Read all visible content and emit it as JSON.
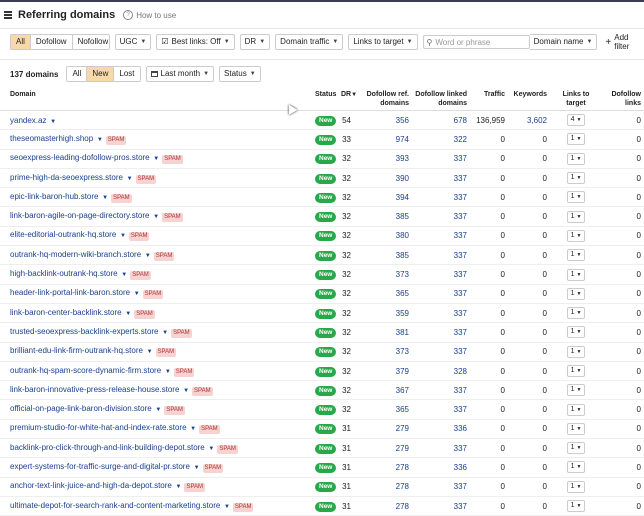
{
  "header": {
    "title": "Referring domains",
    "howto": "How to use"
  },
  "filters": {
    "seg": [
      "All",
      "Dofollow",
      "Nofollow"
    ],
    "ugc": "UGC",
    "best_links": "Best links: Off",
    "dr": "DR",
    "domain_traffic": "Domain traffic",
    "links_to_target": "Links to target",
    "search_placeholder": "Word or phrase",
    "domain_name": "Domain name",
    "add_filter": "Add filter"
  },
  "subbar": {
    "count": "137 domains",
    "seg": [
      "All",
      "New",
      "Lost"
    ],
    "period": "Last month",
    "status": "Status"
  },
  "columns": [
    "Domain",
    "Status",
    "DR",
    "Dofollow ref. domains",
    "Dofollow linked domains",
    "Traffic",
    "Keywords",
    "Links to target",
    "Dofollow links"
  ],
  "spam_label": "SPAM",
  "rows": [
    {
      "domain": "yandex.az",
      "spam": false,
      "status": "New",
      "dr": "54",
      "ref": "356",
      "linked": "678",
      "traffic": "136,959",
      "keywords": "3,602",
      "links": "4",
      "dofollow": "0"
    },
    {
      "domain": "theseomasterhigh.shop",
      "spam": true,
      "status": "New",
      "dr": "33",
      "ref": "974",
      "linked": "322",
      "traffic": "0",
      "keywords": "0",
      "links": "1",
      "dofollow": "0"
    },
    {
      "domain": "seoexpress-leading-dofollow-pros.store",
      "spam": true,
      "status": "New",
      "dr": "32",
      "ref": "393",
      "linked": "337",
      "traffic": "0",
      "keywords": "0",
      "links": "1",
      "dofollow": "0"
    },
    {
      "domain": "prime-high-da-seoexpress.store",
      "spam": true,
      "status": "New",
      "dr": "32",
      "ref": "390",
      "linked": "337",
      "traffic": "0",
      "keywords": "0",
      "links": "1",
      "dofollow": "0"
    },
    {
      "domain": "epic-link-baron-hub.store",
      "spam": true,
      "status": "New",
      "dr": "32",
      "ref": "394",
      "linked": "337",
      "traffic": "0",
      "keywords": "0",
      "links": "1",
      "dofollow": "0"
    },
    {
      "domain": "link-baron-agile-on-page-directory.store",
      "spam": true,
      "status": "New",
      "dr": "32",
      "ref": "385",
      "linked": "337",
      "traffic": "0",
      "keywords": "0",
      "links": "1",
      "dofollow": "0"
    },
    {
      "domain": "elite-editorial-outrank-hq.store",
      "spam": true,
      "status": "New",
      "dr": "32",
      "ref": "380",
      "linked": "337",
      "traffic": "0",
      "keywords": "0",
      "links": "1",
      "dofollow": "0"
    },
    {
      "domain": "outrank-hq-modern-wiki-branch.store",
      "spam": true,
      "status": "New",
      "dr": "32",
      "ref": "385",
      "linked": "337",
      "traffic": "0",
      "keywords": "0",
      "links": "1",
      "dofollow": "0"
    },
    {
      "domain": "high-backlink-outrank-hq.store",
      "spam": true,
      "status": "New",
      "dr": "32",
      "ref": "373",
      "linked": "337",
      "traffic": "0",
      "keywords": "0",
      "links": "1",
      "dofollow": "0"
    },
    {
      "domain": "header-link-portal-link-baron.store",
      "spam": true,
      "status": "New",
      "dr": "32",
      "ref": "365",
      "linked": "337",
      "traffic": "0",
      "keywords": "0",
      "links": "1",
      "dofollow": "0"
    },
    {
      "domain": "link-baron-center-backlink.store",
      "spam": true,
      "status": "New",
      "dr": "32",
      "ref": "359",
      "linked": "337",
      "traffic": "0",
      "keywords": "0",
      "links": "1",
      "dofollow": "0"
    },
    {
      "domain": "trusted-seoexpress-backlink-experts.store",
      "spam": true,
      "status": "New",
      "dr": "32",
      "ref": "381",
      "linked": "337",
      "traffic": "0",
      "keywords": "0",
      "links": "1",
      "dofollow": "0"
    },
    {
      "domain": "brilliant-edu-link-firm-outrank-hq.store",
      "spam": true,
      "status": "New",
      "dr": "32",
      "ref": "373",
      "linked": "337",
      "traffic": "0",
      "keywords": "0",
      "links": "1",
      "dofollow": "0"
    },
    {
      "domain": "outrank-hq-spam-score-dynamic-firm.store",
      "spam": true,
      "status": "New",
      "dr": "32",
      "ref": "379",
      "linked": "328",
      "traffic": "0",
      "keywords": "0",
      "links": "1",
      "dofollow": "0"
    },
    {
      "domain": "link-baron-innovative-press-release-house.store",
      "spam": true,
      "status": "New",
      "dr": "32",
      "ref": "367",
      "linked": "337",
      "traffic": "0",
      "keywords": "0",
      "links": "1",
      "dofollow": "0"
    },
    {
      "domain": "official-on-page-link-baron-division.store",
      "spam": true,
      "status": "New",
      "dr": "32",
      "ref": "365",
      "linked": "337",
      "traffic": "0",
      "keywords": "0",
      "links": "1",
      "dofollow": "0"
    },
    {
      "domain": "premium-studio-for-white-hat-and-index-rate.store",
      "spam": true,
      "status": "New",
      "dr": "31",
      "ref": "279",
      "linked": "336",
      "traffic": "0",
      "keywords": "0",
      "links": "1",
      "dofollow": "0"
    },
    {
      "domain": "backlink-pro-click-through-and-link-building-depot.store",
      "spam": true,
      "status": "New",
      "dr": "31",
      "ref": "279",
      "linked": "337",
      "traffic": "0",
      "keywords": "0",
      "links": "1",
      "dofollow": "0"
    },
    {
      "domain": "expert-systems-for-traffic-surge-and-digital-pr.store",
      "spam": true,
      "status": "New",
      "dr": "31",
      "ref": "278",
      "linked": "336",
      "traffic": "0",
      "keywords": "0",
      "links": "1",
      "dofollow": "0"
    },
    {
      "domain": "anchor-text-link-juice-and-high-da-depot.store",
      "spam": true,
      "status": "New",
      "dr": "31",
      "ref": "278",
      "linked": "337",
      "traffic": "0",
      "keywords": "0",
      "links": "1",
      "dofollow": "0"
    },
    {
      "domain": "ultimate-depot-for-search-rank-and-content-marketing.store",
      "spam": true,
      "status": "New",
      "dr": "31",
      "ref": "278",
      "linked": "337",
      "traffic": "0",
      "keywords": "0",
      "links": "1",
      "dofollow": "0"
    }
  ]
}
